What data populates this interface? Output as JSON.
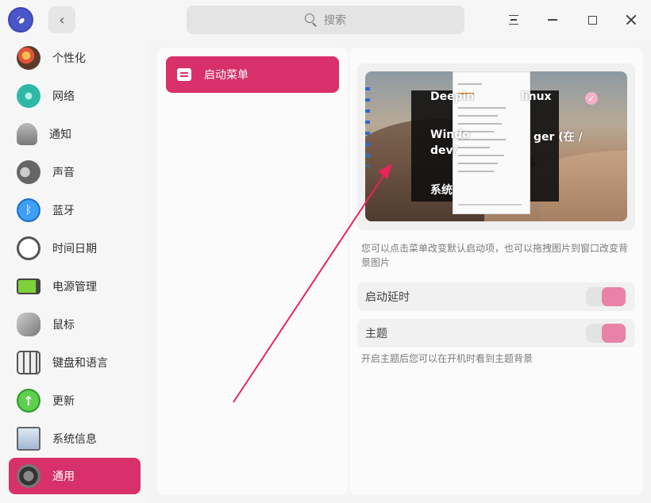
{
  "titlebar": {
    "search_placeholder": "搜索",
    "back_label": "‹"
  },
  "sidebar": {
    "items": [
      {
        "label": "个性化",
        "icon": "palette-icon"
      },
      {
        "label": "网络",
        "icon": "network-icon"
      },
      {
        "label": "通知",
        "icon": "bell-icon"
      },
      {
        "label": "声音",
        "icon": "speaker-icon"
      },
      {
        "label": "蓝牙",
        "icon": "bluetooth-icon"
      },
      {
        "label": "时间日期",
        "icon": "clock-icon"
      },
      {
        "label": "电源管理",
        "icon": "battery-icon"
      },
      {
        "label": "鼠标",
        "icon": "mouse-icon"
      },
      {
        "label": "键盘和语言",
        "icon": "keyboard-icon"
      },
      {
        "label": "更新",
        "icon": "update-icon"
      },
      {
        "label": "系统信息",
        "icon": "system-info-icon"
      },
      {
        "label": "通用",
        "icon": "gear-icon",
        "active": true
      }
    ]
  },
  "middle": {
    "boot_menu_label": "启动菜单"
  },
  "preview": {
    "entries": [
      "Deepin",
      "linux",
      "Windo",
      "ger (在 /",
      "dev/",
      "系统"
    ],
    "check": "✓"
  },
  "settings": {
    "preview_hint": "您可以点击菜单改变默认启动项，也可以拖拽图片到窗口改变背景图片",
    "boot_delay_label": "启动延时",
    "boot_delay_on": true,
    "theme_label": "主题",
    "theme_on": true,
    "theme_hint": "开启主题后您可以在开机时看到主题背景"
  },
  "colors": {
    "accent": "#d8306a",
    "toggle_on": "#e882a6"
  }
}
